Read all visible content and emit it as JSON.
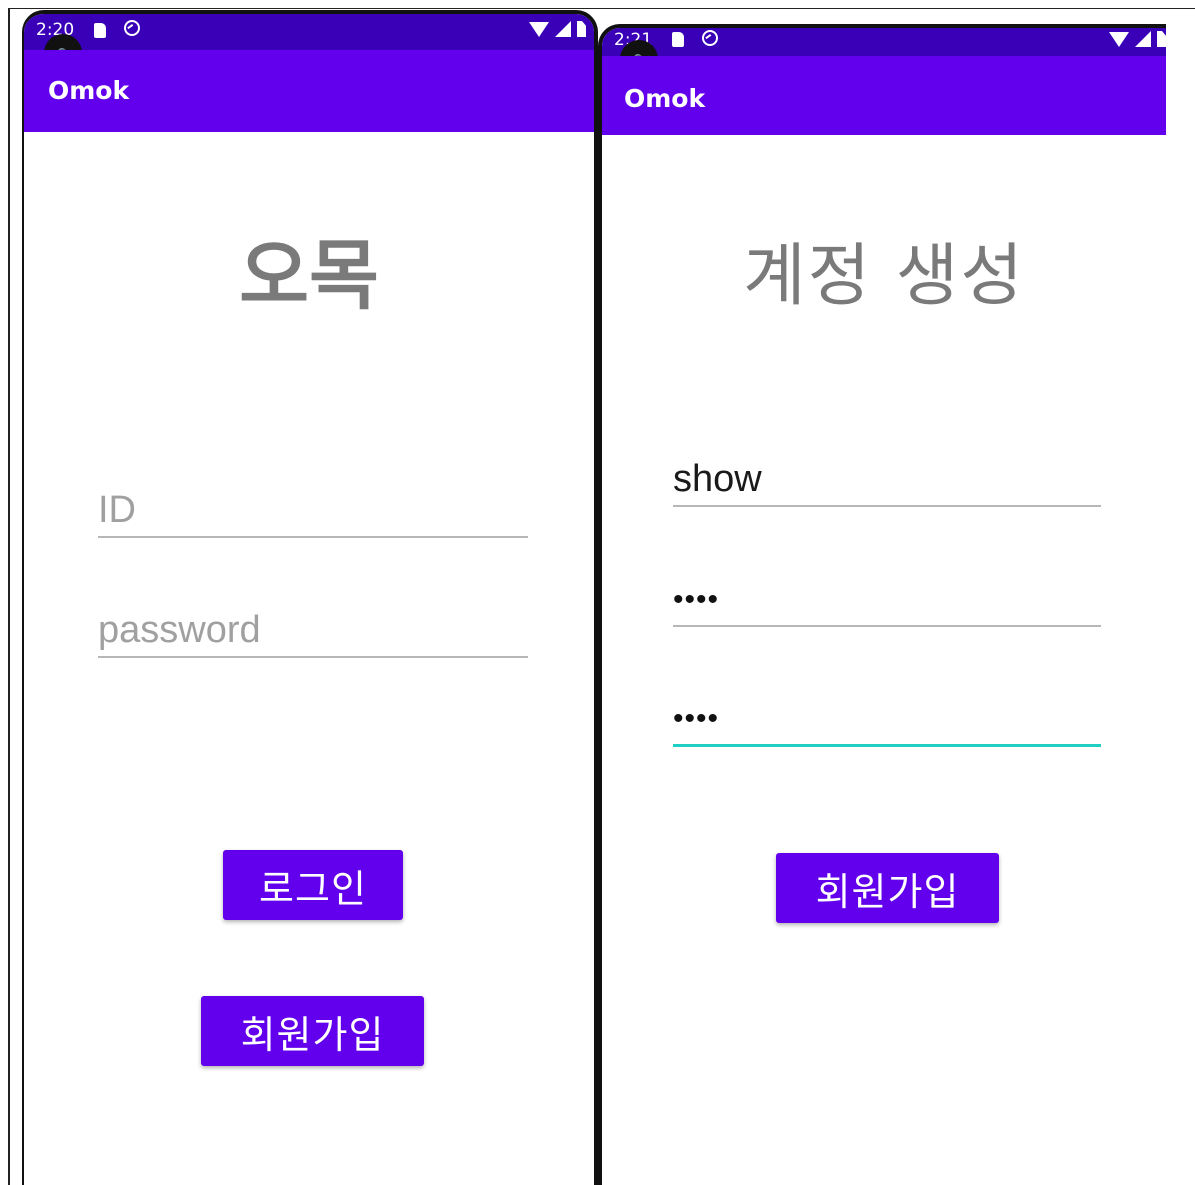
{
  "colors": {
    "status_bar": "#3a00b8",
    "app_bar": "#6200ee",
    "headline_text": "#7a7a7a",
    "field_underline": "#b7b7b7",
    "field_focus": "#1fcfc4",
    "button": "#6200ee"
  },
  "login_screen": {
    "status": {
      "time": "2:20",
      "icons": [
        "sd-card-icon",
        "sync-icon",
        "wifi-icon",
        "signal-icon",
        "battery-icon"
      ]
    },
    "app_title": "Omok",
    "headline": "오목",
    "id_field": {
      "placeholder": "ID",
      "value": ""
    },
    "password_field": {
      "placeholder": "password",
      "value": ""
    },
    "login_button": "로그인",
    "signup_button": "회원가입"
  },
  "signup_screen": {
    "status": {
      "time": "2:21",
      "icons": [
        "sd-card-icon",
        "sync-icon",
        "wifi-icon",
        "signal-icon",
        "battery-icon"
      ]
    },
    "app_title": "Omok",
    "headline": "계정 생성",
    "id_field": {
      "value": "show"
    },
    "password_field": {
      "value": "••••"
    },
    "confirm_password_field": {
      "value": "••••"
    },
    "signup_button": "회원가입"
  }
}
